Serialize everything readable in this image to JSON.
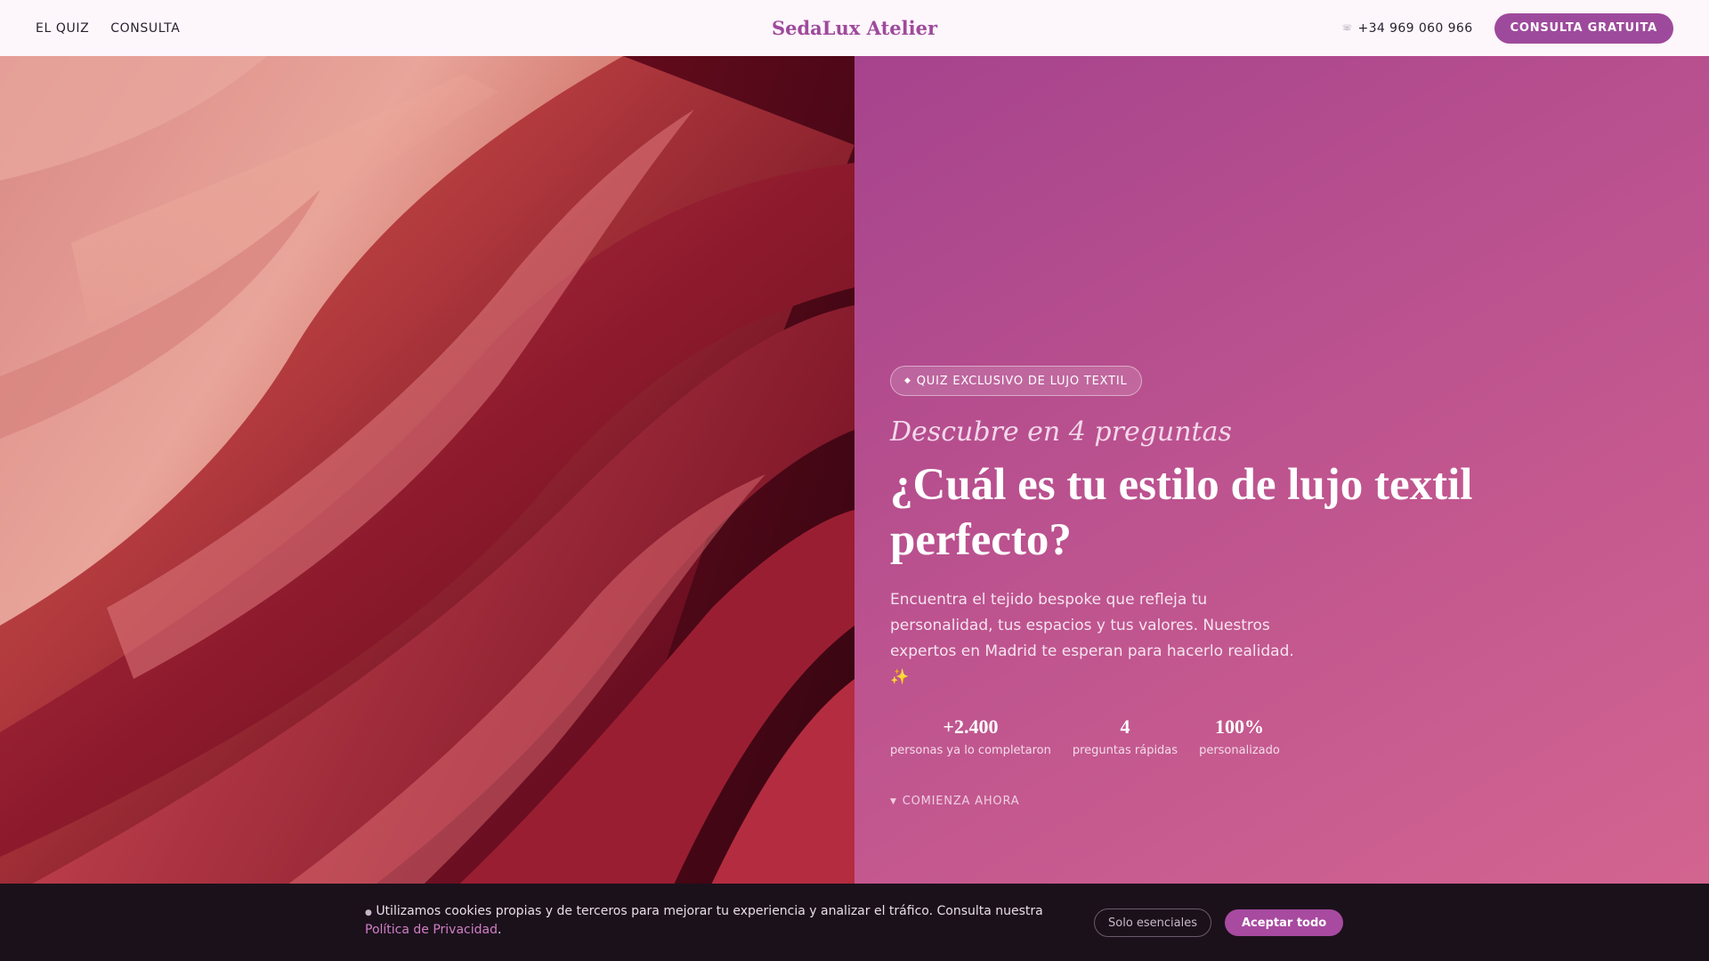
{
  "brand": {
    "name": "SedaLux Atelier",
    "color": "#9e4a9c"
  },
  "nav": {
    "links": [
      "EL QUIZ",
      "CONSULTA"
    ],
    "phone": "+34 969 060 966",
    "phone_icon": "phone-icon",
    "cta": "CONSULTA GRATUITA"
  },
  "hero": {
    "image_subject": "draped silk fabric in coral and crimson",
    "badge": "QUIZ EXCLUSIVO DE LUJO TEXTIL",
    "badge_icon": "gem-icon",
    "subtitle": "Descubre en 4 preguntas",
    "headline": "¿Cuál es tu estilo de lujo textil perfecto?",
    "lead": "Encuentra el tejido bespoke que refleja tu personalidad, tus espacios y tus valores. Nuestros expertos en Madrid te esperan para hacerlo realidad.",
    "lead_emoji": "✨",
    "stats": [
      {
        "value": "+2.400",
        "label": "personas ya lo completaron"
      },
      {
        "value": "4",
        "label": "preguntas rápidas"
      },
      {
        "value": "100%",
        "label": "personalizado"
      }
    ],
    "start_label": "COMIENZA AHORA",
    "start_icon": "arrow-down-icon",
    "panel_colors": [
      "#a6438d",
      "#d56690"
    ]
  },
  "cookie": {
    "text": "Utilizamos cookies propias y de terceros para mejorar tu experiencia y analizar el tráfico. Consulta nuestra",
    "link": "Política de Privacidad",
    "after_link": ".",
    "essential_button": "Solo esenciales",
    "accept_button": "Aceptar todo",
    "background": "#1b111b"
  }
}
